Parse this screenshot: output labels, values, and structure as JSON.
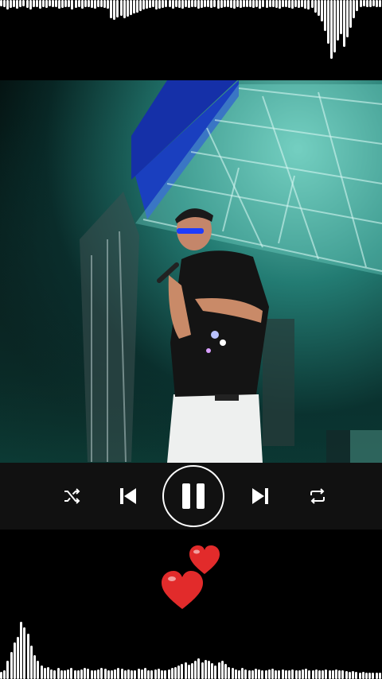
{
  "player": {
    "controls": {
      "shuffle_icon": "shuffle-icon",
      "previous_icon": "skip-previous-icon",
      "play_pause_icon": "pause-icon",
      "next_icon": "skip-next-icon",
      "repeat_icon": "repeat-icon"
    },
    "visualizer": {
      "color": "#ffffff",
      "top_levels": [
        0.1,
        0.12,
        0.15,
        0.13,
        0.11,
        0.14,
        0.12,
        0.1,
        0.13,
        0.15,
        0.12,
        0.11,
        0.14,
        0.12,
        0.13,
        0.1,
        0.11,
        0.12,
        0.14,
        0.13,
        0.12,
        0.11,
        0.15,
        0.13,
        0.12,
        0.14,
        0.11,
        0.12,
        0.13,
        0.14,
        0.12,
        0.11,
        0.13,
        0.14,
        0.3,
        0.32,
        0.28,
        0.26,
        0.3,
        0.27,
        0.24,
        0.22,
        0.2,
        0.18,
        0.16,
        0.14,
        0.13,
        0.12,
        0.15,
        0.14,
        0.13,
        0.12,
        0.11,
        0.14,
        0.12,
        0.13,
        0.14,
        0.12,
        0.13,
        0.11,
        0.12,
        0.14,
        0.13,
        0.12,
        0.11,
        0.13,
        0.12,
        0.14,
        0.13,
        0.12,
        0.11,
        0.13,
        0.14,
        0.12,
        0.13,
        0.12,
        0.11,
        0.12,
        0.13,
        0.12,
        0.14,
        0.12,
        0.13,
        0.11,
        0.12,
        0.13,
        0.14,
        0.12,
        0.11,
        0.13,
        0.14,
        0.12,
        0.13,
        0.12,
        0.14,
        0.15,
        0.13,
        0.2,
        0.26,
        0.35,
        0.5,
        0.7,
        0.95,
        0.85,
        0.65,
        0.55,
        0.75,
        0.6,
        0.45,
        0.3,
        0.18,
        0.12,
        0.1,
        0.11,
        0.12,
        0.1,
        0.11,
        0.12
      ],
      "bottom_levels": [
        0.12,
        0.14,
        0.3,
        0.45,
        0.6,
        0.7,
        0.95,
        0.85,
        0.75,
        0.55,
        0.4,
        0.3,
        0.22,
        0.18,
        0.2,
        0.16,
        0.14,
        0.18,
        0.15,
        0.14,
        0.16,
        0.18,
        0.14,
        0.15,
        0.16,
        0.18,
        0.17,
        0.15,
        0.14,
        0.16,
        0.18,
        0.17,
        0.15,
        0.14,
        0.16,
        0.18,
        0.17,
        0.15,
        0.16,
        0.14,
        0.15,
        0.17,
        0.16,
        0.18,
        0.15,
        0.14,
        0.16,
        0.17,
        0.15,
        0.14,
        0.16,
        0.18,
        0.2,
        0.22,
        0.25,
        0.28,
        0.24,
        0.26,
        0.3,
        0.34,
        0.28,
        0.32,
        0.3,
        0.26,
        0.22,
        0.28,
        0.3,
        0.25,
        0.2,
        0.18,
        0.16,
        0.15,
        0.18,
        0.16,
        0.14,
        0.15,
        0.17,
        0.16,
        0.15,
        0.14,
        0.16,
        0.17,
        0.15,
        0.14,
        0.16,
        0.15,
        0.14,
        0.16,
        0.15,
        0.14,
        0.16,
        0.17,
        0.15,
        0.14,
        0.16,
        0.15,
        0.14,
        0.16,
        0.15,
        0.14,
        0.16,
        0.15,
        0.14,
        0.13,
        0.12,
        0.13,
        0.12,
        0.11,
        0.12,
        0.11,
        0.1,
        0.1,
        0.1,
        0.1
      ]
    },
    "hearts": {
      "color": "#e22b2b",
      "icons": [
        "heart-icon",
        "heart-icon"
      ]
    }
  }
}
